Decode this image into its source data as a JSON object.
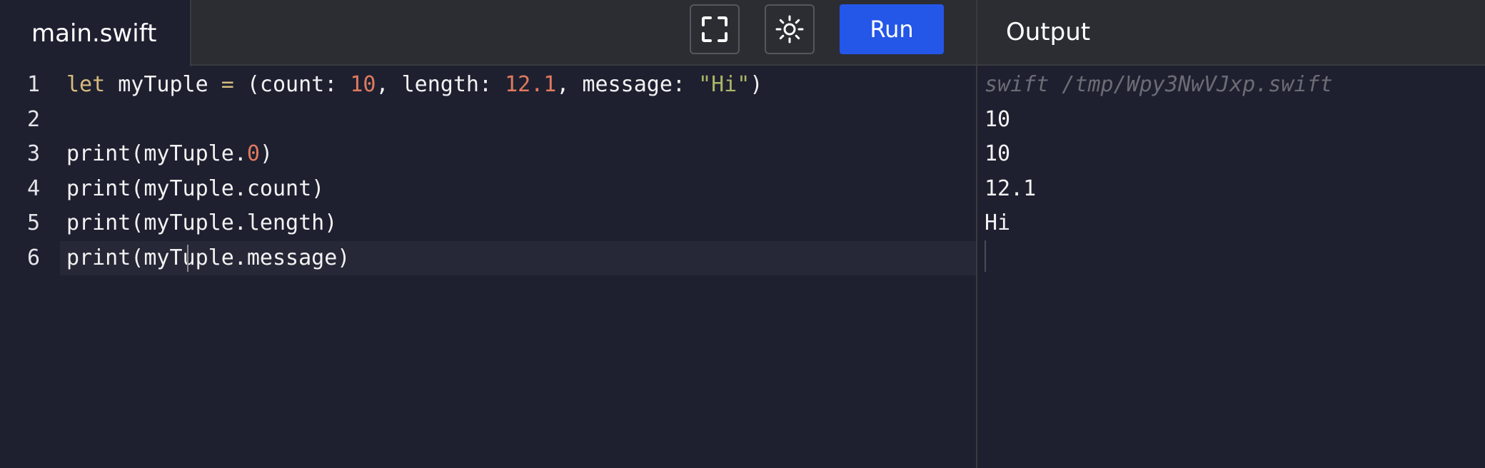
{
  "editor": {
    "file_tab_label": "main.swift",
    "toolbar": {
      "fullscreen_icon": "fullscreen-icon",
      "theme_icon": "sun-icon",
      "run_label": "Run",
      "run_color": "#2457e8"
    },
    "lines": [
      {
        "number": "1",
        "tokens": [
          {
            "type": "kw",
            "text": "let"
          },
          {
            "type": "plain",
            "text": " myTuple "
          },
          {
            "type": "op",
            "text": "="
          },
          {
            "type": "plain",
            "text": " (count: "
          },
          {
            "type": "num",
            "text": "10"
          },
          {
            "type": "plain",
            "text": ", length: "
          },
          {
            "type": "num",
            "text": "12.1"
          },
          {
            "type": "plain",
            "text": ", message: "
          },
          {
            "type": "str",
            "text": "\"Hi\""
          },
          {
            "type": "plain",
            "text": ")"
          }
        ]
      },
      {
        "number": "2",
        "tokens": []
      },
      {
        "number": "3",
        "tokens": [
          {
            "type": "plain",
            "text": "print(myTuple."
          },
          {
            "type": "num",
            "text": "0"
          },
          {
            "type": "plain",
            "text": ")"
          }
        ]
      },
      {
        "number": "4",
        "tokens": [
          {
            "type": "plain",
            "text": "print(myTuple.count)"
          }
        ]
      },
      {
        "number": "5",
        "tokens": [
          {
            "type": "plain",
            "text": "print(myTuple.length)"
          }
        ]
      },
      {
        "number": "6",
        "active": true,
        "tokens": [
          {
            "type": "plain",
            "text": "print(myTuple.message)"
          }
        ]
      }
    ]
  },
  "output": {
    "title": "Output",
    "command": "swift /tmp/Wpy3NwVJxp.swift",
    "lines": [
      "10",
      "10",
      "12.1",
      "Hi"
    ]
  },
  "colors": {
    "background": "#1e2030",
    "header": "#2c2d33",
    "keyword": "#d7ba7d",
    "number": "#e07a5f",
    "string": "#a9b665"
  }
}
